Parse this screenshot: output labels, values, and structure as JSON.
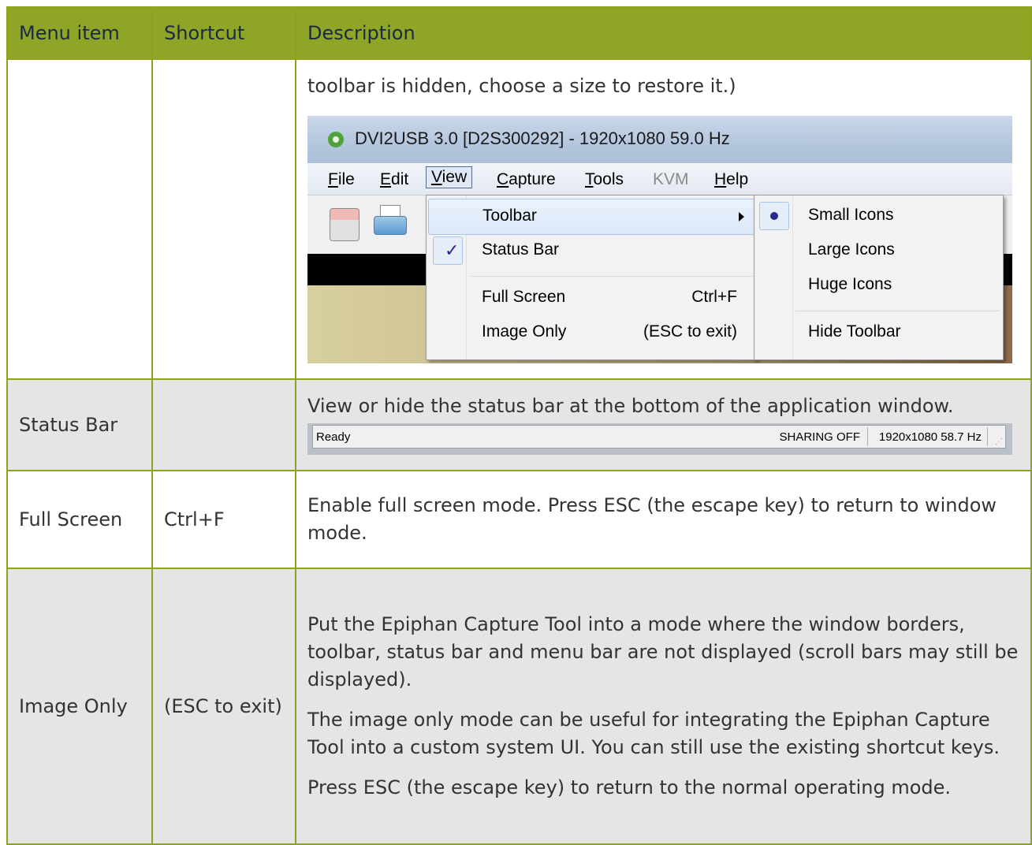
{
  "table": {
    "headers": [
      "Menu item",
      "Shortcut",
      "Description"
    ],
    "row_toolbar": {
      "menu_item": "",
      "shortcut": "",
      "description": "toolbar is hidden, choose a size to restore it.)"
    },
    "row_status": {
      "menu_item": "Status Bar",
      "shortcut": "",
      "description": "View or hide the status bar at the bottom of the application window."
    },
    "row_fullscreen": {
      "menu_item": "Full Screen",
      "shortcut": "Ctrl+F",
      "description": "Enable full screen mode. Press ESC (the escape key) to return to window mode."
    },
    "row_imageonly": {
      "menu_item": "Image Only",
      "shortcut": "(ESC to exit)",
      "description": [
        "Put the Epiphan Capture Tool into a mode where the window borders, toolbar, status bar and menu bar are not displayed (scroll bars may still be displayed).",
        "The image only mode can be useful for integrating the Epiphan Capture Tool into a custom system UI. You can still use the existing shortcut keys.",
        "Press ESC (the escape key) to return to the normal operating mode."
      ]
    }
  },
  "app_screenshot": {
    "title": "DVI2USB 3.0 [D2S300292]  - 1920x1080 59.0 Hz",
    "menubar": {
      "file_first": "F",
      "file_rest": "ile",
      "edit_first": "E",
      "edit_rest": "dit",
      "view_first": "V",
      "view_rest": "iew",
      "capture_first": "C",
      "capture_rest": "apture",
      "tools_first": "T",
      "tools_rest": "ools",
      "kvm": "KVM",
      "help_first": "H",
      "help_rest": "elp"
    },
    "view_menu": {
      "toolbar": "Toolbar",
      "status_bar": "Status Bar",
      "full_screen": "Full Screen",
      "full_screen_shortcut": "Ctrl+F",
      "image_only": "Image Only",
      "image_only_shortcut": "(ESC to exit)"
    },
    "toolbar_submenu": {
      "small_icons": "Small Icons",
      "large_icons": "Large Icons",
      "huge_icons": "Huge Icons",
      "hide_toolbar": "Hide Toolbar"
    }
  },
  "statusbar_screenshot": {
    "ready": "Ready",
    "sharing": "SHARING OFF",
    "resolution": "1920x1080 58.7 Hz"
  },
  "colors": {
    "header_bg": "#8fa526",
    "header_text": "#1a2a44",
    "border": "#8fa11f",
    "grey_row": "#e5e5e5"
  },
  "icons": [
    "epiphan-logo-icon",
    "save-icon",
    "print-icon",
    "submenu-arrow-icon",
    "checkmark-icon",
    "radio-dot-icon",
    "resize-grip-icon"
  ]
}
